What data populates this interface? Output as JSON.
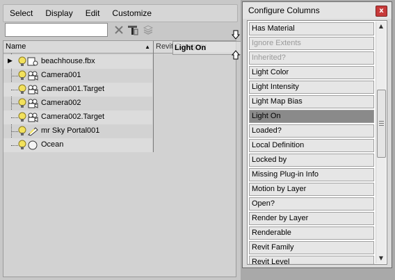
{
  "menu": [
    "Select",
    "Display",
    "Edit",
    "Customize"
  ],
  "search": {
    "value": "",
    "placeholder": ""
  },
  "toolbar_icons": [
    "clear-search-icon",
    "filter-icon",
    "layers-icon"
  ],
  "columns": {
    "name": "Name",
    "revit": "Revit Category"
  },
  "drag_ghost": "Light On",
  "rows": [
    {
      "label": "beachhouse.fbx",
      "icon": "root-object-icon",
      "expanded": false
    },
    {
      "label": "Camera001",
      "icon": "camera-icon"
    },
    {
      "label": "Camera001.Target",
      "icon": "camera-icon"
    },
    {
      "label": "Camera002",
      "icon": "camera-icon"
    },
    {
      "label": "Camera002.Target",
      "icon": "camera-icon"
    },
    {
      "label": "mr Sky Portal001",
      "icon": "sky-portal-icon"
    },
    {
      "label": "Ocean",
      "icon": "sphere-icon"
    }
  ],
  "dialog": {
    "title": "Configure Columns",
    "close": "x",
    "items": [
      {
        "label": "Has Material",
        "state": "normal"
      },
      {
        "label": "Ignore Extents",
        "state": "disabled"
      },
      {
        "label": "Inherited?",
        "state": "disabled"
      },
      {
        "label": "Light Color",
        "state": "normal"
      },
      {
        "label": "Light Intensity",
        "state": "normal"
      },
      {
        "label": "Light Map Bias",
        "state": "normal"
      },
      {
        "label": "Light On",
        "state": "selected"
      },
      {
        "label": "Loaded?",
        "state": "normal"
      },
      {
        "label": "Local Definition",
        "state": "normal"
      },
      {
        "label": "Locked by",
        "state": "normal"
      },
      {
        "label": "Missing Plug-in Info",
        "state": "normal"
      },
      {
        "label": "Motion by Layer",
        "state": "normal"
      },
      {
        "label": "Open?",
        "state": "normal"
      },
      {
        "label": "Render by Layer",
        "state": "normal"
      },
      {
        "label": "Renderable",
        "state": "normal"
      },
      {
        "label": "Revit Family",
        "state": "normal"
      },
      {
        "label": "Revit Level",
        "state": "normal"
      }
    ]
  },
  "colors": {
    "selected": "#8a8a8a",
    "close": "#c73a3a",
    "bulb": "#f2e15c"
  }
}
